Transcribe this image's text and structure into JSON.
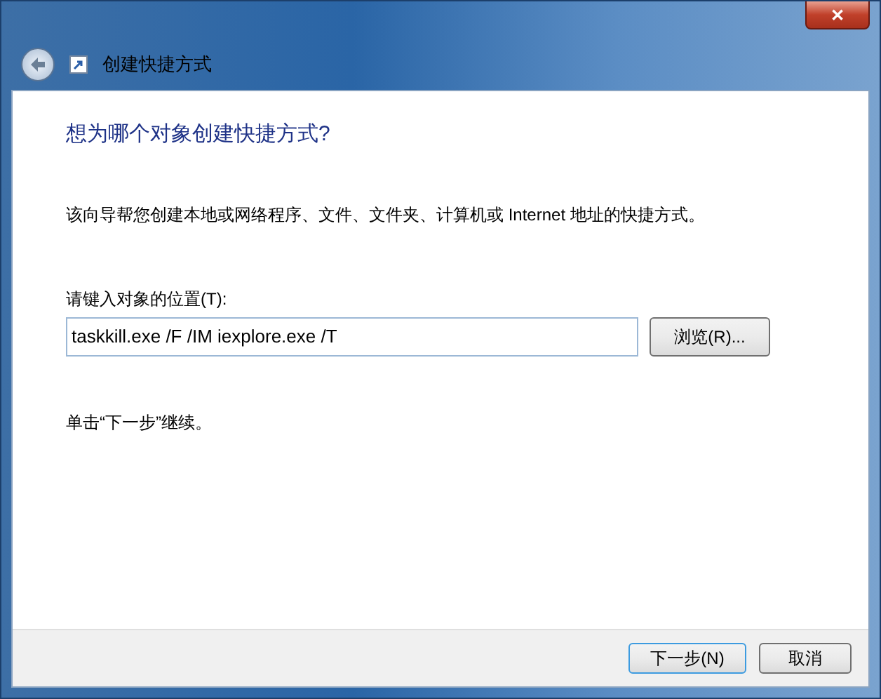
{
  "window": {
    "title": "创建快捷方式",
    "close": "✕"
  },
  "heading": "想为哪个对象创建快捷方式?",
  "description": "该向导帮您创建本地或网络程序、文件、文件夹、计算机或 Internet 地址的快捷方式。",
  "location": {
    "label": "请键入对象的位置(T):",
    "value": "taskkill.exe /F /IM iexplore.exe /T",
    "browse": "浏览(R)..."
  },
  "hint": "单击“下一步”继续。",
  "buttons": [
    {
      "label": "下一步(N)",
      "default": true
    },
    {
      "label": "取消",
      "default": false
    }
  ]
}
